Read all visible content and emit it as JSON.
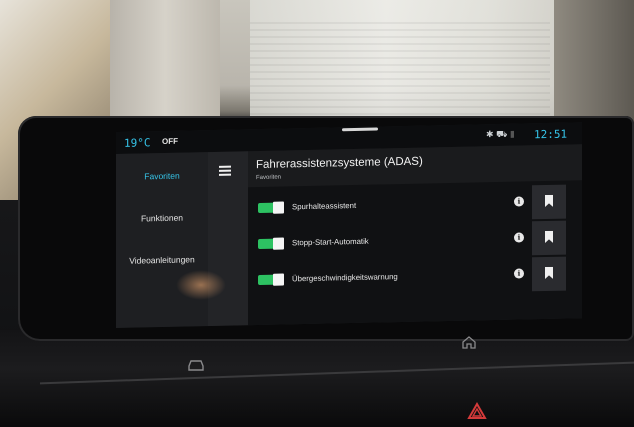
{
  "status": {
    "temperature": "19°C",
    "ac_mode": "OFF",
    "time": "12:51",
    "icons": [
      "bluetooth-icon",
      "car-icon",
      "signal-icon"
    ]
  },
  "sidebar": {
    "items": [
      {
        "label": "Favoriten",
        "active": true
      },
      {
        "label": "Funktionen",
        "active": false
      },
      {
        "label": "Videoanleitungen",
        "active": false
      }
    ]
  },
  "header": {
    "title": "Fahrerassistenzsysteme (ADAS)",
    "subtitle": "Favoriten"
  },
  "rows": [
    {
      "label": "Spurhalteassistent",
      "enabled": true
    },
    {
      "label": "Stopp-Start-Automatik",
      "enabled": true
    },
    {
      "label": "Übergeschwindigkeitswarnung",
      "enabled": true
    }
  ],
  "colors": {
    "accent": "#36c4e8",
    "toggle_on": "#2dc262",
    "background": "#18191b"
  }
}
